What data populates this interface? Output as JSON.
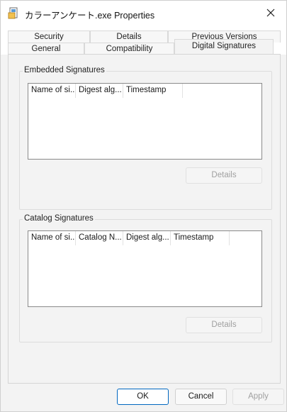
{
  "window": {
    "title": "カラーアンケート.exe Properties",
    "close_icon": "close-icon",
    "app_icon": "file-icon"
  },
  "tabs": {
    "row1": [
      {
        "label": "Security"
      },
      {
        "label": "Details"
      },
      {
        "label": "Previous Versions"
      }
    ],
    "row2": [
      {
        "label": "General"
      },
      {
        "label": "Compatibility"
      },
      {
        "label": "Digital Signatures",
        "active": true
      }
    ]
  },
  "embedded": {
    "group_label": "Embedded Signatures",
    "columns": [
      "Name of si...",
      "Digest alg...",
      "Timestamp"
    ],
    "details_label": "Details"
  },
  "catalog": {
    "group_label": "Catalog Signatures",
    "columns": [
      "Name of si...",
      "Catalog N...",
      "Digest alg...",
      "Timestamp"
    ],
    "details_label": "Details"
  },
  "footer": {
    "ok_label": "OK",
    "cancel_label": "Cancel",
    "apply_label": "Apply"
  },
  "colors": {
    "accent": "#0067c0",
    "disabled_text": "#a0a0a0"
  }
}
